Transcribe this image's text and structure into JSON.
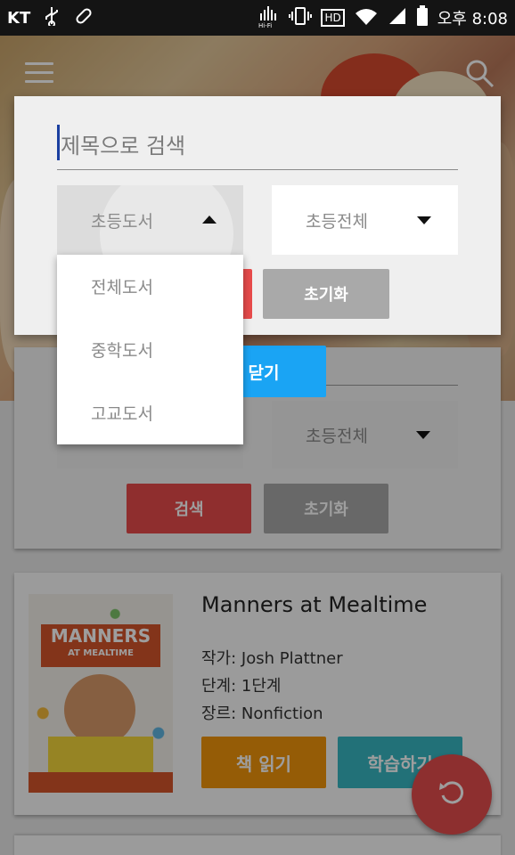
{
  "status_bar": {
    "carrier": "KT",
    "hd_label": "HD",
    "time_prefix": "오후",
    "time": "8:08"
  },
  "background": {
    "search_select_right": "초등전체",
    "search_button": "검색",
    "reset_button": "초기화",
    "close_button": "닫기"
  },
  "book": {
    "cover_title": "MANNERS",
    "cover_subtitle": "AT MEALTIME",
    "title": "Manners at Mealtime",
    "author": "작가: Josh Plattner",
    "level": "단계: 1단계",
    "genre": "장르: Nonfiction",
    "read_button": "책 읽기",
    "learn_button": "학습하기"
  },
  "dialog": {
    "search_placeholder": "제목으로 검색",
    "category_selected": "초등도서",
    "grade_selected": "초등전체",
    "reset_button": "초기화",
    "dropdown_options": [
      "전체도서",
      "중학도서",
      "고교도서"
    ]
  },
  "colors": {
    "red": "#e74b4b",
    "gray": "#a9a9a9",
    "blue": "#1aa4f4",
    "orange": "#f0950a",
    "teal": "#38b6c2"
  }
}
